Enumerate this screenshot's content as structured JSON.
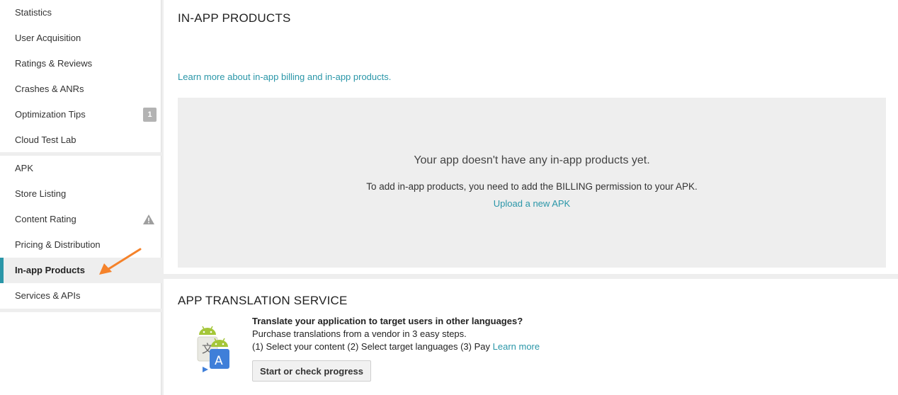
{
  "sidebar": {
    "group1": [
      {
        "label": "Statistics"
      },
      {
        "label": "User Acquisition"
      },
      {
        "label": "Ratings & Reviews"
      },
      {
        "label": "Crashes & ANRs"
      },
      {
        "label": "Optimization Tips",
        "badge": "1"
      },
      {
        "label": "Cloud Test Lab"
      }
    ],
    "group2": [
      {
        "label": "APK"
      },
      {
        "label": "Store Listing"
      },
      {
        "label": "Content Rating",
        "icon": "warning-icon"
      },
      {
        "label": "Pricing & Distribution"
      },
      {
        "label": "In-app Products",
        "active": true
      },
      {
        "label": "Services & APIs"
      }
    ]
  },
  "annotation": {
    "icon": "arrow-icon",
    "color": "#f5822a"
  },
  "inapp": {
    "title": "IN-APP PRODUCTS",
    "learn_link": "Learn more about in-app billing and in-app products.",
    "empty_title": "Your app doesn't have any in-app products yet.",
    "empty_text": "To add in-app products, you need to add the BILLING permission to your APK.",
    "upload_link": "Upload a new APK"
  },
  "translation": {
    "title": "APP TRANSLATION SERVICE",
    "icon": "translate-android-icon",
    "headline": "Translate your application to target users in other languages?",
    "line1": "Purchase translations from a vendor in 3 easy steps.",
    "line2": "(1) Select your content (2) Select target languages (3) Pay",
    "learn_more": "Learn more",
    "button": "Start or check progress"
  },
  "colors": {
    "accent": "#2a96a8",
    "android_green": "#a4c639",
    "translate_blue": "#3f7fd9"
  }
}
